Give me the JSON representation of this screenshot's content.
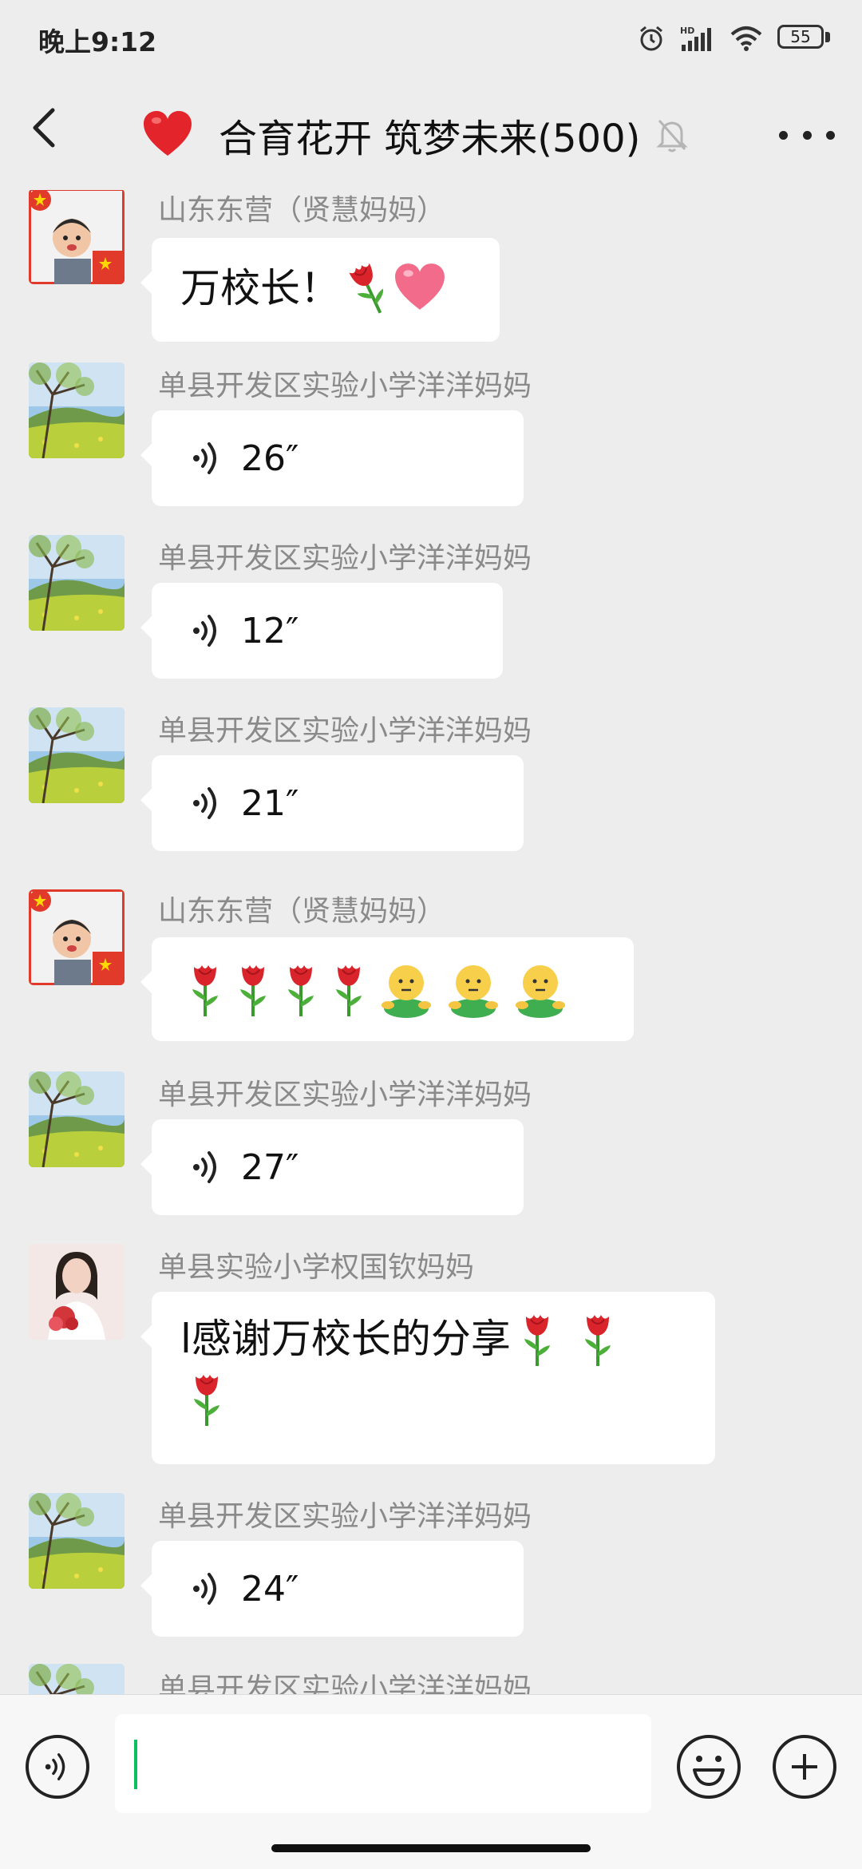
{
  "status_bar": {
    "time": "晚上9:12",
    "battery": "55"
  },
  "header": {
    "title": "合育花开 筑梦未来(500)",
    "icons": [
      "back-arrow-icon",
      "heart-icon",
      "mute-bell-icon",
      "more-icon"
    ]
  },
  "messages": [
    {
      "sender": "山东东营（贤慧妈妈）",
      "type": "text",
      "text": "万校长！"
    },
    {
      "sender": "单县开发区实验小学洋洋妈妈",
      "type": "voice",
      "duration": "26″"
    },
    {
      "sender": "单县开发区实验小学洋洋妈妈",
      "type": "voice",
      "duration": "12″"
    },
    {
      "sender": "单县开发区实验小学洋洋妈妈",
      "type": "voice",
      "duration": "21″"
    },
    {
      "sender": "山东东营（贤慧妈妈）",
      "type": "emoji",
      "text": ""
    },
    {
      "sender": "单县开发区实验小学洋洋妈妈",
      "type": "voice",
      "duration": "27″"
    },
    {
      "sender": "单县实验小学权国钦妈妈",
      "type": "text",
      "text": "l感谢万校长的分享"
    },
    {
      "sender": "单县开发区实验小学洋洋妈妈",
      "type": "voice",
      "duration": "24″"
    },
    {
      "sender": "单县开发区实验小学洋洋妈妈",
      "type": "partial"
    }
  ],
  "colors": {
    "background": "#ededed",
    "bubble": "#ffffff",
    "caret": "#07c160",
    "sender": "#8a8a8a"
  }
}
